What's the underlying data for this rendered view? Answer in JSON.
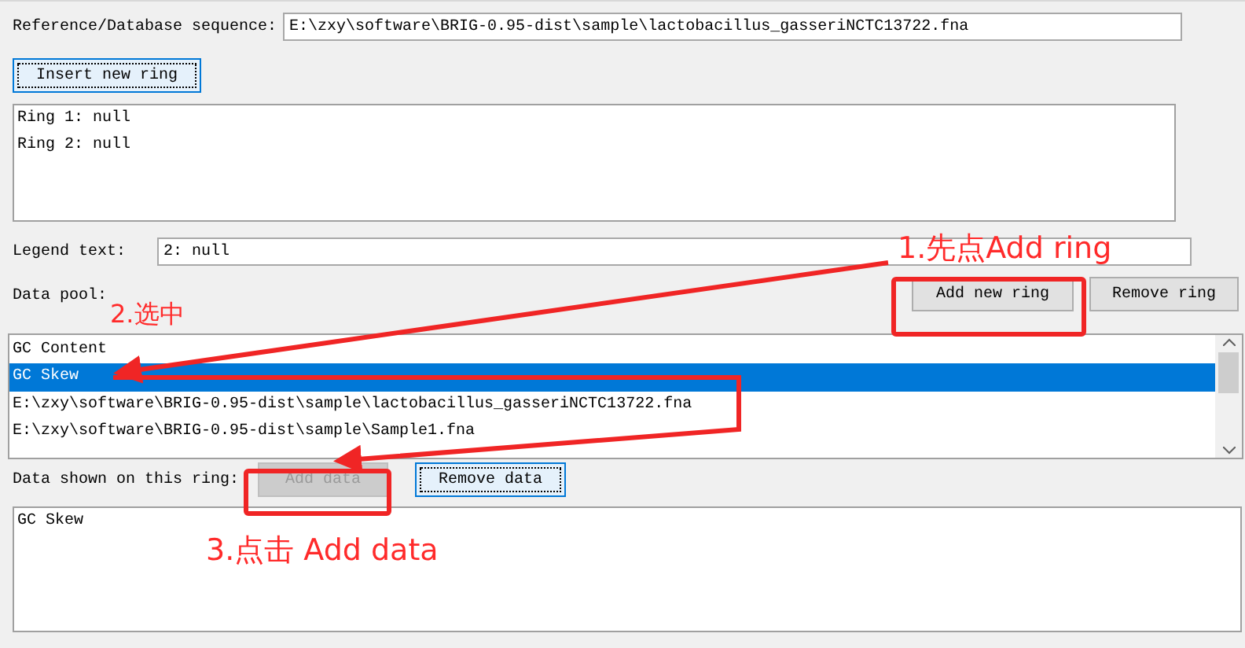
{
  "reference": {
    "label": "Reference/Database sequence:",
    "value": "E:\\zxy\\software\\BRIG-0.95-dist\\sample\\lactobacillus_gasseriNCTC13722.fna"
  },
  "insert_button": {
    "label": "Insert new ring",
    "focused": true
  },
  "rings": [
    "Ring 1: null",
    "Ring 2: null"
  ],
  "legend": {
    "label": "Legend text:",
    "value": "2: null"
  },
  "data_pool_label": "Data pool:",
  "ring_buttons": [
    {
      "label": "Add new ring",
      "disabled": false,
      "focused": false
    },
    {
      "label": "Remove ring",
      "disabled": false,
      "focused": false
    }
  ],
  "data_pool": [
    {
      "text": "GC Content",
      "selected": false
    },
    {
      "text": "GC Skew",
      "selected": true
    },
    {
      "text": "E:\\zxy\\software\\BRIG-0.95-dist\\sample\\lactobacillus_gasseriNCTC13722.fna",
      "selected": false
    },
    {
      "text": "E:\\zxy\\software\\BRIG-0.95-dist\\sample\\Sample1.fna",
      "selected": false
    }
  ],
  "data_shown_label": "Data shown on this ring:",
  "data_buttons": [
    {
      "label": "Add data",
      "disabled": true,
      "focused": false
    },
    {
      "label": "Remove data",
      "disabled": false,
      "focused": true
    }
  ],
  "data_shown": [
    "GC Skew"
  ],
  "annotations": [
    {
      "text": "1.先点Add ring"
    },
    {
      "text": "2.选中"
    },
    {
      "text": "3.点击 Add data"
    }
  ]
}
